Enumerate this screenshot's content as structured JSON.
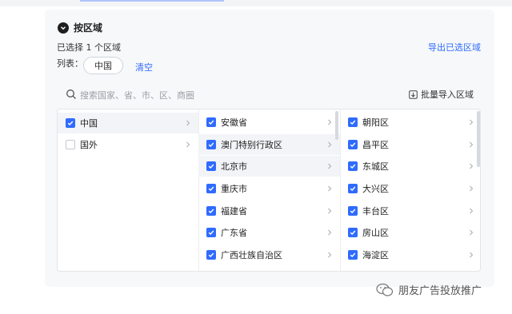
{
  "section": {
    "title": "按区域"
  },
  "summary": {
    "selected_text": "已选择 1 个区域",
    "export_label": "导出已选区域"
  },
  "list": {
    "label": "列表：",
    "chip": "中国",
    "clear_label": "清空"
  },
  "search": {
    "placeholder": "搜索国家、省、市、区、商圈",
    "bulk_import_label": "批量导入区域"
  },
  "columns": {
    "countries": [
      {
        "label": "中国",
        "checked": true
      },
      {
        "label": "国外",
        "checked": false
      }
    ],
    "provinces": [
      {
        "label": "安徽省",
        "checked": true
      },
      {
        "label": "澳门特别行政区",
        "checked": true
      },
      {
        "label": "北京市",
        "checked": true
      },
      {
        "label": "重庆市",
        "checked": true
      },
      {
        "label": "福建省",
        "checked": true
      },
      {
        "label": "广东省",
        "checked": true
      },
      {
        "label": "广西壮族自治区",
        "checked": true
      }
    ],
    "districts": [
      {
        "label": "朝阳区",
        "checked": true
      },
      {
        "label": "昌平区",
        "checked": true
      },
      {
        "label": "东城区",
        "checked": true
      },
      {
        "label": "大兴区",
        "checked": true
      },
      {
        "label": "丰台区",
        "checked": true
      },
      {
        "label": "房山区",
        "checked": true
      },
      {
        "label": "海淀区",
        "checked": true
      }
    ]
  },
  "watermark": {
    "text": "朋友广告投放推广"
  },
  "colors": {
    "accent": "#2f6bff",
    "panel_bg": "#f7f8fa"
  }
}
